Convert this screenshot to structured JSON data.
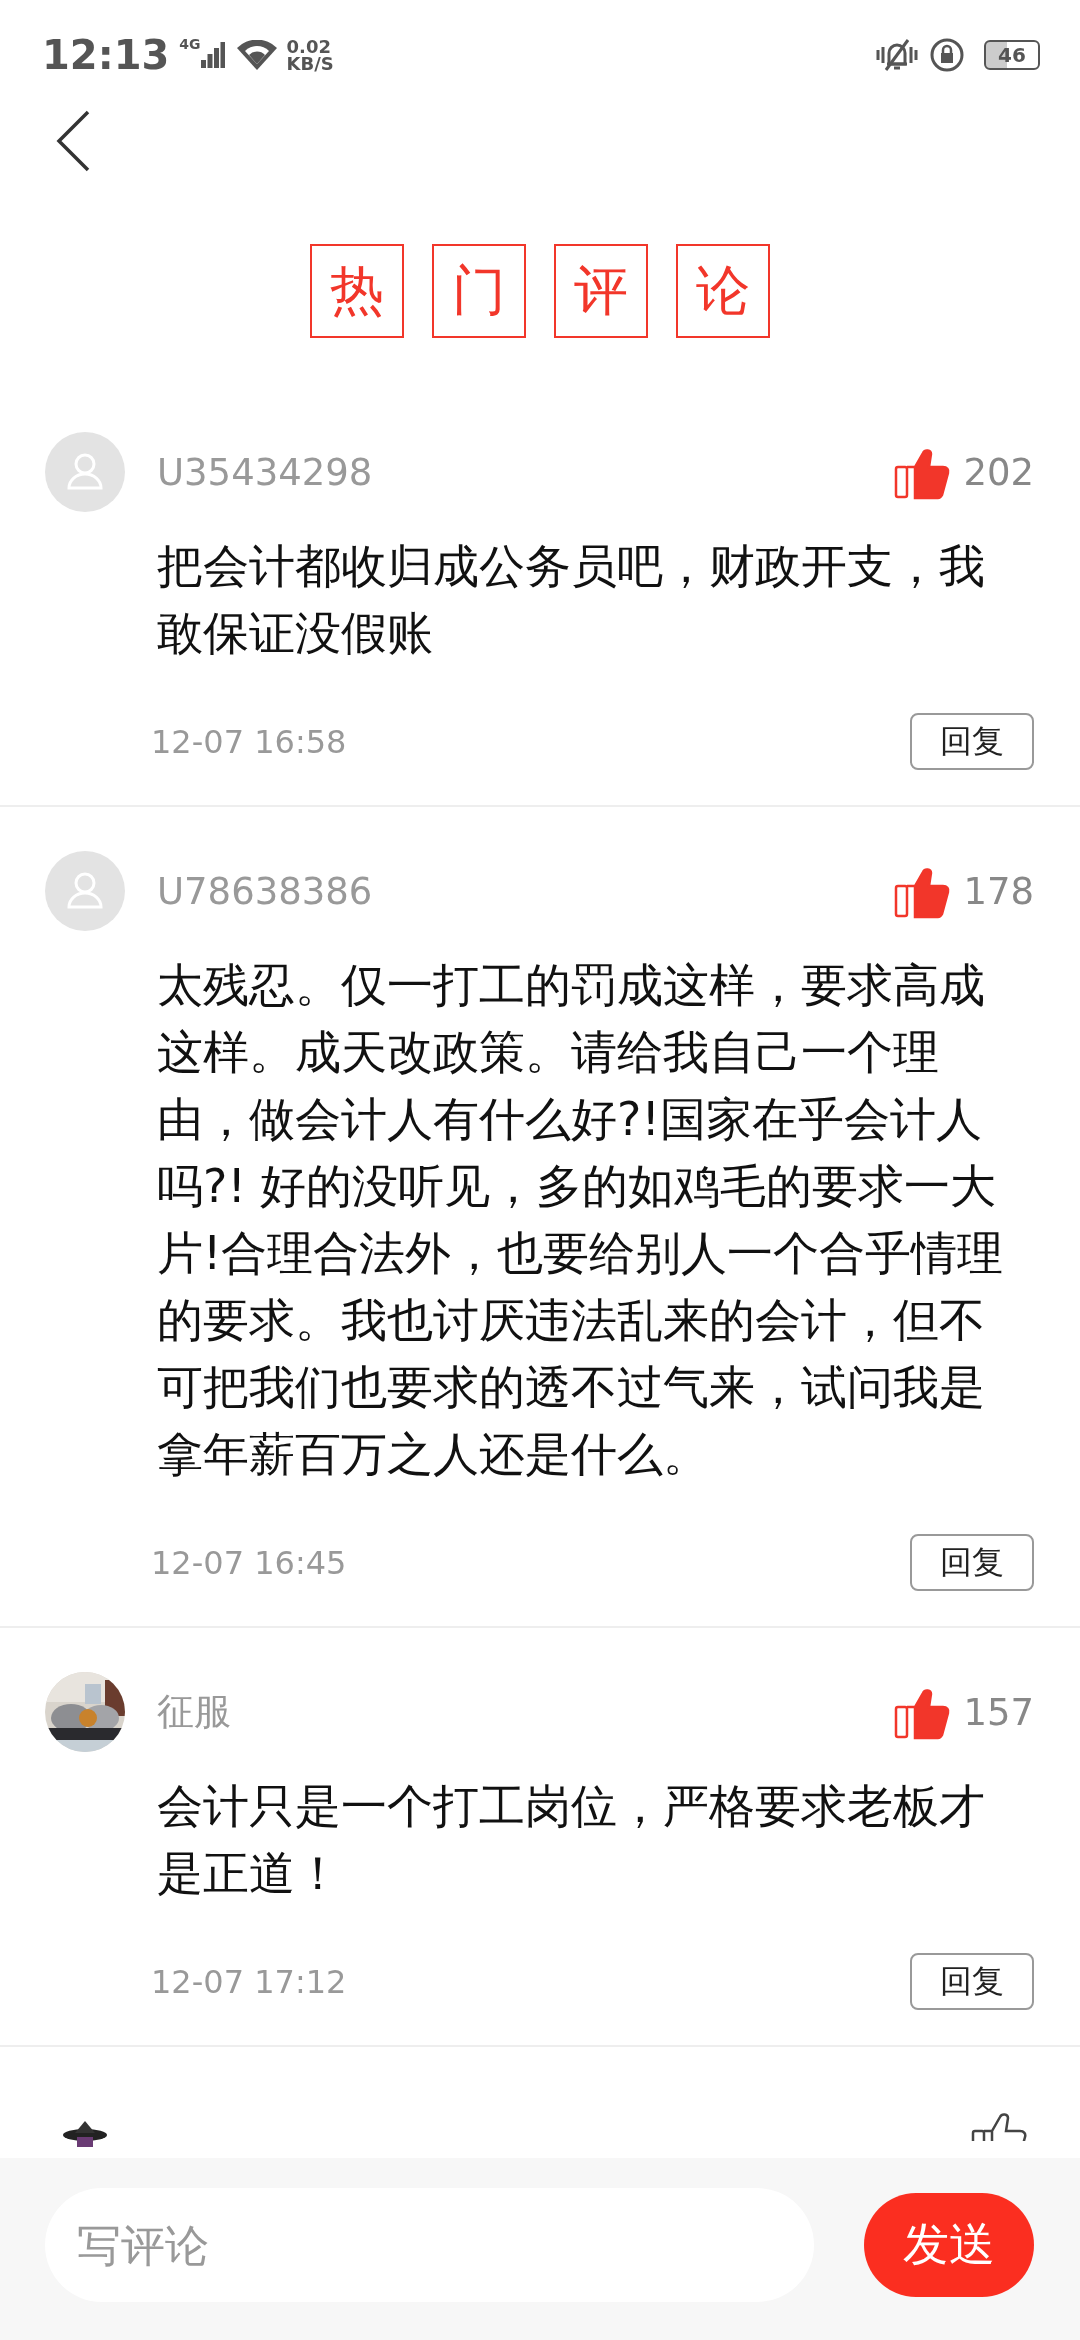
{
  "status_bar": {
    "time": "12:13",
    "network": "4G",
    "speed": "0.02",
    "speed_unit": "KB/S",
    "battery": "46"
  },
  "header": {
    "title_chars": [
      "热",
      "门",
      "评",
      "论"
    ]
  },
  "comments": [
    {
      "avatar": {
        "kind": "default"
      },
      "user": "U35434298",
      "liked": true,
      "likes": "202",
      "text": "把会计都收归成公务员吧，财政开支，我敢保证没假账",
      "date": "12-07 16:58",
      "reply": "回复"
    },
    {
      "avatar": {
        "kind": "default"
      },
      "user": "U78638386",
      "liked": true,
      "likes": "178",
      "text": "太残忍。仅一打工的罚成这样，要求高成这样。成天改政策。请给我自己一个理由，做会计人有什么好?!国家在乎会计人吗?! 好的没听见，多的如鸡毛的要求一大片!合理合法外，也要给别人一个合乎情理的要求。我也讨厌违法乱来的会计，但不可把我们也要求的透不过气来，试问我是拿年薪百万之人还是什么。",
      "date": "12-07 16:45",
      "reply": "回复"
    },
    {
      "user": "征服",
      "liked": true,
      "likes": "157",
      "text": "会计只是一个打工岗位，严格要求老板才是正道！",
      "date": "12-07 17:12",
      "reply": "回复"
    },
    {
      "avatar": {
        "kind": "figure"
      },
      "liked": false
    }
  ],
  "compose": {
    "placeholder": "写评论",
    "send": "发送"
  }
}
